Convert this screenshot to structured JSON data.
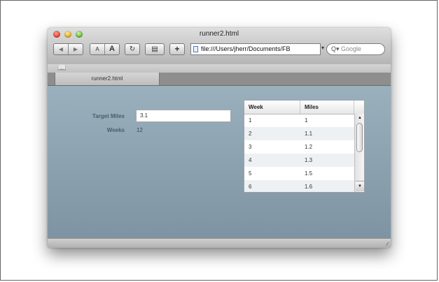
{
  "window": {
    "title": "runner2.html",
    "tab_label": "runner2.html"
  },
  "toolbar": {
    "back_icon": "back-arrow-icon",
    "forward_icon": "forward-arrow-icon",
    "text_smaller_label": "A",
    "text_bigger_label": "A",
    "reload_icon": "reload-icon",
    "snapback_icon": "snapback-icon",
    "add_bookmark_label": "+",
    "url": "file:///Users/jherr/Documents/FB",
    "search_placeholder": "Google"
  },
  "form": {
    "target_miles_label": "Target Miles",
    "target_miles_value": "3.1",
    "weeks_label": "Weeks",
    "weeks_value": "12"
  },
  "grid": {
    "columns": [
      "Week",
      "Miles"
    ],
    "rows": [
      {
        "week": "1",
        "miles": "1"
      },
      {
        "week": "2",
        "miles": "1.1"
      },
      {
        "week": "3",
        "miles": "1.2"
      },
      {
        "week": "4",
        "miles": "1.3"
      },
      {
        "week": "5",
        "miles": "1.5"
      },
      {
        "week": "6",
        "miles": "1.6"
      }
    ]
  },
  "colors": {
    "content_background": "#8ea3b0",
    "window_chrome": "#c8c8c8"
  }
}
